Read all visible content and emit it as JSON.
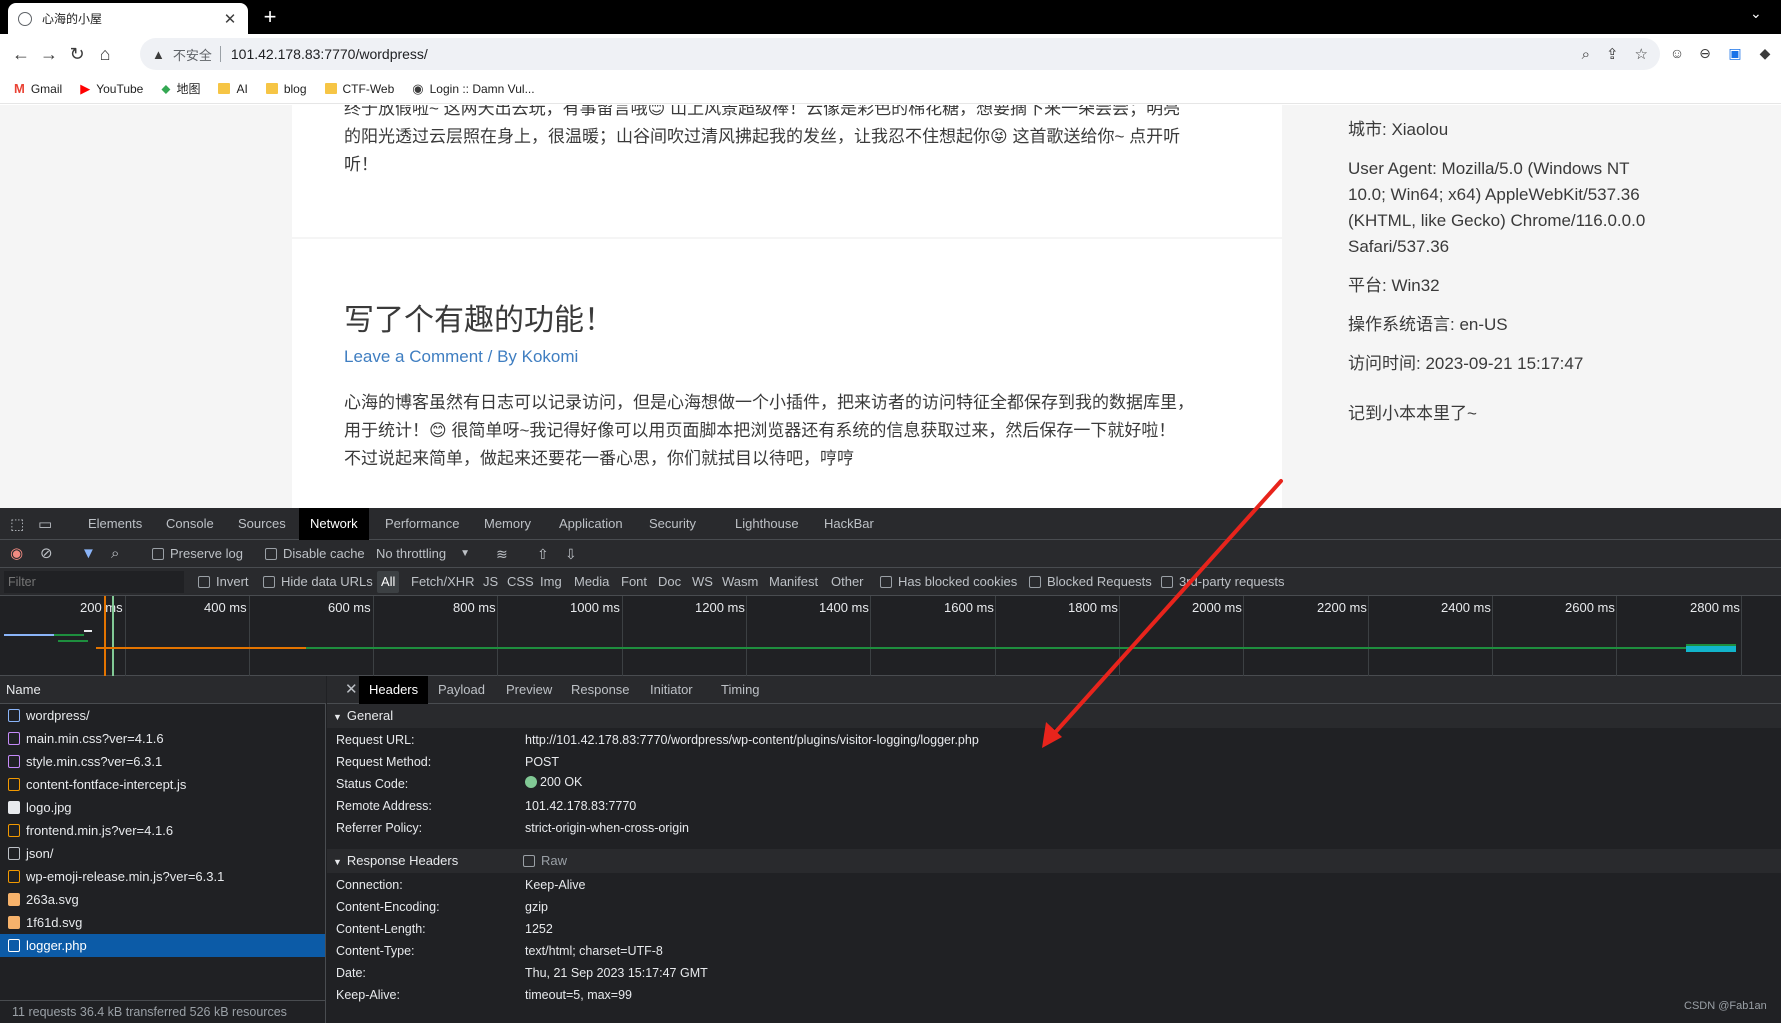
{
  "browser": {
    "tab_title": "心海的小屋",
    "tab_close": "✕",
    "new_tab": "+",
    "insecure_label": "不安全",
    "url": "101.42.178.83:7770/wordpress/",
    "bookmarks": [
      {
        "label": "Gmail",
        "icon": "gmail-icon"
      },
      {
        "label": "YouTube",
        "icon": "youtube-icon"
      },
      {
        "label": "地图",
        "icon": "maps-icon"
      },
      {
        "label": "AI",
        "icon": "folder-icon"
      },
      {
        "label": "blog",
        "icon": "folder-icon"
      },
      {
        "label": "CTF-Web",
        "icon": "folder-icon"
      },
      {
        "label": "Login :: Damn Vul...",
        "icon": "globe-icon"
      }
    ]
  },
  "page": {
    "post1_text_line1": "终于放假啦~ 这两天出去玩，有事留言哦😊 山上风景超级棒！云像是彩色的棉花糖，想要摘下来一朵尝尝；明亮",
    "post1_text_line2": "的阳光透过云层照在身上，很温暖；山谷间吹过清风拂起我的发丝，让我忍不住想起你😝 这首歌送给你~ 点开听",
    "post1_text_line3": "听！",
    "post2_title": "写了个有趣的功能！",
    "post2_meta": "Leave a Comment / By Kokomi",
    "post2_text_line1": "心海的博客虽然有日志可以记录访问，但是心海想做一个小插件，把来访者的访问特征全都保存到我的数据库里，",
    "post2_text_line2": "用于统计！😊 很简单呀~我记得好像可以用页面脚本把浏览器还有系统的信息获取过来，然后保存一下就好啦！",
    "post2_text_line3": "不过说起来简单，做起来还要花一番心思，你们就拭目以待吧，哼哼",
    "sidebar": {
      "city": "城市: Xiaolou",
      "user_agent": "User Agent: Mozilla/5.0 (Windows NT 10.0; Win64; x64) AppleWebKit/537.36 (KHTML, like Gecko) Chrome/116.0.0.0 Safari/537.36",
      "platform": "平台: Win32",
      "os_lang": "操作系统语言: en-US",
      "visit_time": "访问时间: 2023-09-21 15:17:47",
      "note": "记到小本本里了~"
    }
  },
  "devtools": {
    "tabs": [
      "Elements",
      "Console",
      "Sources",
      "Network",
      "Performance",
      "Memory",
      "Application",
      "Security",
      "Lighthouse",
      "HackBar"
    ],
    "active_tab": "Network",
    "toolbar": {
      "preserve_log": "Preserve log",
      "disable_cache": "Disable cache",
      "throttling": "No throttling"
    },
    "filter": {
      "placeholder": "Filter",
      "invert": "Invert",
      "hide_data_urls": "Hide data URLs",
      "types": [
        "All",
        "Fetch/XHR",
        "JS",
        "CSS",
        "Img",
        "Media",
        "Font",
        "Doc",
        "WS",
        "Wasm",
        "Manifest",
        "Other"
      ],
      "has_blocked_cookies": "Has blocked cookies",
      "blocked_requests": "Blocked Requests",
      "third_party": "3rd-party requests"
    },
    "timeline_ticks": [
      "200 ms",
      "400 ms",
      "600 ms",
      "800 ms",
      "1000 ms",
      "1200 ms",
      "1400 ms",
      "1600 ms",
      "1800 ms",
      "2000 ms",
      "2200 ms",
      "2400 ms",
      "2600 ms",
      "2800 ms"
    ],
    "name_header": "Name",
    "requests": [
      {
        "name": "wordpress/",
        "type": "doc"
      },
      {
        "name": "main.min.css?ver=4.1.6",
        "type": "css"
      },
      {
        "name": "style.min.css?ver=6.3.1",
        "type": "css"
      },
      {
        "name": "content-fontface-intercept.js",
        "type": "js"
      },
      {
        "name": "logo.jpg",
        "type": "img"
      },
      {
        "name": "frontend.min.js?ver=4.1.6",
        "type": "js"
      },
      {
        "name": "json/",
        "type": "other"
      },
      {
        "name": "wp-emoji-release.min.js?ver=6.3.1",
        "type": "js"
      },
      {
        "name": "263a.svg",
        "type": "svg"
      },
      {
        "name": "1f61d.svg",
        "type": "svg"
      },
      {
        "name": "logger.php",
        "type": "fetch"
      }
    ],
    "selected_request": "logger.php",
    "status_summary": "11 requests    36.4 kB transferred    526 kB resources",
    "detail_tabs": [
      "Headers",
      "Payload",
      "Preview",
      "Response",
      "Initiator",
      "Timing"
    ],
    "active_detail_tab": "Headers",
    "general_title": "General",
    "general": [
      {
        "key": "Request URL:",
        "value": "http://101.42.178.83:7770/wordpress/wp-content/plugins/visitor-logging/logger.php"
      },
      {
        "key": "Request Method:",
        "value": "POST"
      },
      {
        "key": "Status Code:",
        "value": "200 OK"
      },
      {
        "key": "Remote Address:",
        "value": "101.42.178.83:7770"
      },
      {
        "key": "Referrer Policy:",
        "value": "strict-origin-when-cross-origin"
      }
    ],
    "response_headers_title": "Response Headers",
    "raw_label": "Raw",
    "response_headers": [
      {
        "key": "Connection:",
        "value": "Keep-Alive"
      },
      {
        "key": "Content-Encoding:",
        "value": "gzip"
      },
      {
        "key": "Content-Length:",
        "value": "1252"
      },
      {
        "key": "Content-Type:",
        "value": "text/html; charset=UTF-8"
      },
      {
        "key": "Date:",
        "value": "Thu, 21 Sep 2023 15:17:47 GMT"
      },
      {
        "key": "Keep-Alive:",
        "value": "timeout=5, max=99"
      }
    ]
  },
  "watermark": "CSDN @Fab1an",
  "colors": {
    "annotation_arrow": "#e8241c",
    "link": "#3f7ec1",
    "selected_row": "#0c5ba7",
    "status_ok": "#81c995"
  }
}
